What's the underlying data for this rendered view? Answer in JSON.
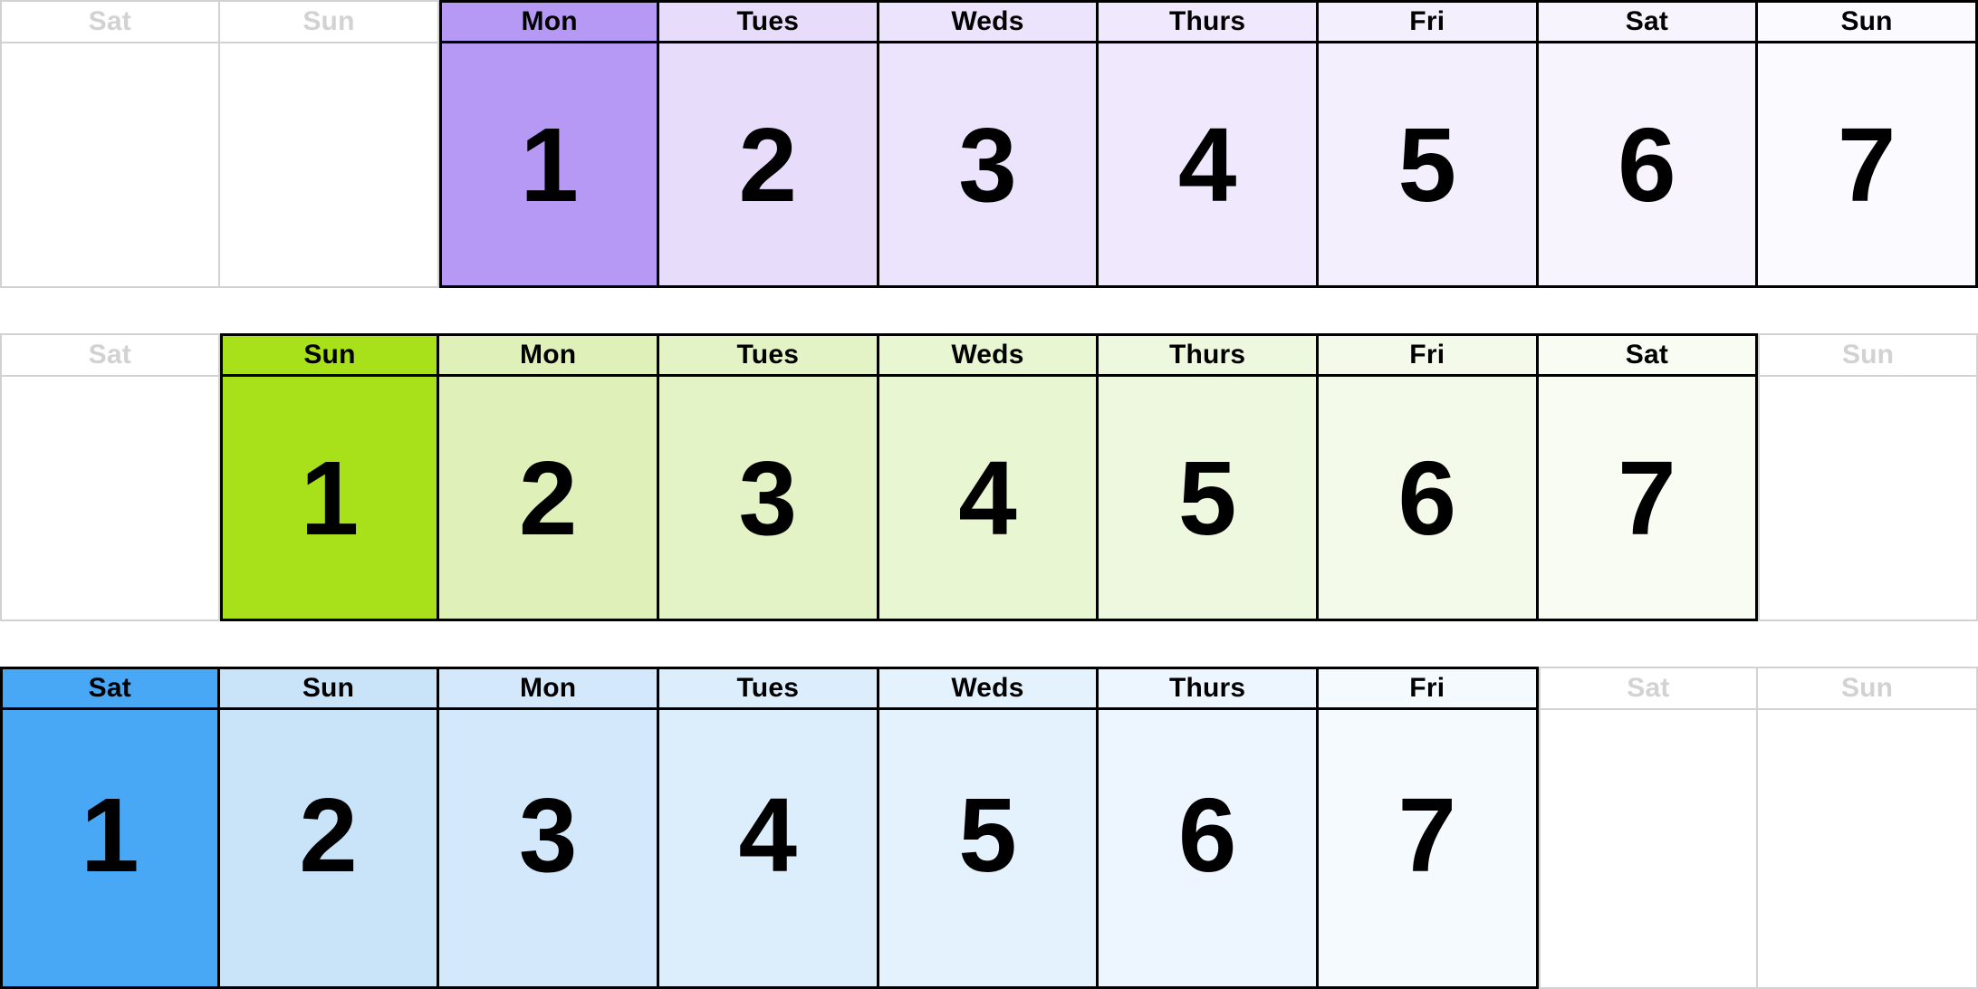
{
  "calendar": {
    "columns": 9,
    "weekday_labels": [
      "Sat",
      "Sun",
      "Mon",
      "Tues",
      "Weds",
      "Thurs",
      "Fri",
      "Sat",
      "Sun"
    ],
    "accents": {
      "purple": "#b599f5",
      "green": "#a8e01a",
      "blue": "#48a8f5",
      "inactive_border": "#d2d2d2",
      "inactive_text": "#d2d2d2",
      "active_border": "#000000",
      "active_text": "#000000",
      "page_background": "#ffffff"
    },
    "rows": [
      {
        "name": "week-starting-monday",
        "accent_name": "purple",
        "accent": "#b599f5",
        "first_active_index": 2,
        "cells": [
          {
            "weekday": "Sat",
            "day": "",
            "active": false,
            "fill": "#ffffff"
          },
          {
            "weekday": "Sun",
            "day": "",
            "active": false,
            "fill": "#ffffff"
          },
          {
            "weekday": "Mon",
            "day": "1",
            "active": true,
            "fill": "#b599f5"
          },
          {
            "weekday": "Tues",
            "day": "2",
            "active": true,
            "fill": "#e8dcfb"
          },
          {
            "weekday": "Weds",
            "day": "3",
            "active": true,
            "fill": "#ece3fc"
          },
          {
            "weekday": "Thurs",
            "day": "4",
            "active": true,
            "fill": "#f0e9fd"
          },
          {
            "weekday": "Fri",
            "day": "5",
            "active": true,
            "fill": "#f3effd"
          },
          {
            "weekday": "Sat",
            "day": "6",
            "active": true,
            "fill": "#f7f4fe"
          },
          {
            "weekday": "Sun",
            "day": "7",
            "active": true,
            "fill": "#fbfaff"
          }
        ]
      },
      {
        "name": "week-starting-sunday",
        "accent_name": "green",
        "accent": "#a8e01a",
        "first_active_index": 1,
        "cells": [
          {
            "weekday": "Sat",
            "day": "",
            "active": false,
            "fill": "#ffffff"
          },
          {
            "weekday": "Sun",
            "day": "1",
            "active": true,
            "fill": "#a8e01a"
          },
          {
            "weekday": "Mon",
            "day": "2",
            "active": true,
            "fill": "#dff0b8"
          },
          {
            "weekday": "Tues",
            "day": "3",
            "active": true,
            "fill": "#e4f3c5"
          },
          {
            "weekday": "Weds",
            "day": "4",
            "active": true,
            "fill": "#e9f6d2"
          },
          {
            "weekday": "Thurs",
            "day": "5",
            "active": true,
            "fill": "#eef8de"
          },
          {
            "weekday": "Fri",
            "day": "6",
            "active": true,
            "fill": "#f3fae9"
          },
          {
            "weekday": "Sat",
            "day": "7",
            "active": true,
            "fill": "#f8fcf3"
          },
          {
            "weekday": "Sun",
            "day": "",
            "active": false,
            "fill": "#ffffff"
          }
        ]
      },
      {
        "name": "week-starting-saturday",
        "accent_name": "blue",
        "accent": "#48a8f5",
        "first_active_index": 0,
        "cells": [
          {
            "weekday": "Sat",
            "day": "1",
            "active": true,
            "fill": "#48a8f5"
          },
          {
            "weekday": "Sun",
            "day": "2",
            "active": true,
            "fill": "#c9e4f9"
          },
          {
            "weekday": "Mon",
            "day": "3",
            "active": true,
            "fill": "#d3e9fb"
          },
          {
            "weekday": "Tues",
            "day": "4",
            "active": true,
            "fill": "#dcedfc"
          },
          {
            "weekday": "Weds",
            "day": "5",
            "active": true,
            "fill": "#e4f2fd"
          },
          {
            "weekday": "Thurs",
            "day": "6",
            "active": true,
            "fill": "#edf6fe"
          },
          {
            "weekday": "Fri",
            "day": "7",
            "active": true,
            "fill": "#f5fafe"
          },
          {
            "weekday": "Sat",
            "day": "",
            "active": false,
            "fill": "#ffffff"
          },
          {
            "weekday": "Sun",
            "day": "",
            "active": false,
            "fill": "#ffffff"
          }
        ]
      }
    ]
  }
}
